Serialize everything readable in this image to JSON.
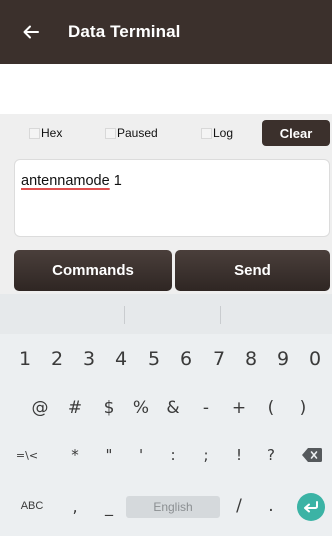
{
  "header": {
    "title": "Data Terminal",
    "back_icon": "arrow-left-icon"
  },
  "options": {
    "hex_label": "Hex",
    "paused_label": "Paused",
    "log_label": "Log",
    "clear_label": "Clear"
  },
  "terminal": {
    "input_word": "antennamode",
    "input_rest": " 1"
  },
  "actions": {
    "commands_label": "Commands",
    "send_label": "Send"
  },
  "keyboard": {
    "numbers": [
      "1",
      "2",
      "3",
      "4",
      "5",
      "6",
      "7",
      "8",
      "9",
      "0"
    ],
    "symbols1": [
      "@",
      "#",
      "$",
      "%",
      "&",
      "-",
      "+",
      "(",
      ")"
    ],
    "symbols2": [
      "=\\<",
      "*",
      "\"",
      "'",
      ":",
      ";",
      "!",
      "?"
    ],
    "abc_label": "ABC",
    "comma": ",",
    "underscore": "_",
    "space_label": "English",
    "slash": "/",
    "period": ".",
    "backspace_icon": "backspace-icon",
    "enter_icon": "enter-icon"
  },
  "colors": {
    "app_bar": "#3b302c",
    "enter_key": "#3bb3a5"
  }
}
